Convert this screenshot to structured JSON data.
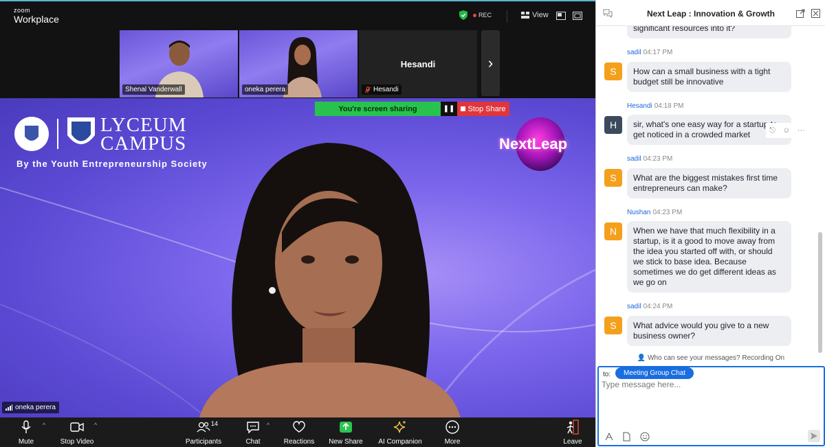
{
  "app": {
    "logo_line1": "zoom",
    "logo_line2": "Workplace",
    "rec_label": "REC",
    "view_label": "View"
  },
  "thumbnails": [
    {
      "name": "Shenal Vanderwall"
    },
    {
      "name": "oneka perera"
    },
    {
      "name": "Hesandi",
      "display_name": "Hesandi",
      "muted": true
    }
  ],
  "main": {
    "screen_sharing_label": "You're screen sharing",
    "stop_share_label": "Stop Share",
    "brand_title_line1": "LYCEUM",
    "brand_title_line2": "CAMPUS",
    "brand_subtitle": "By the Youth Entrepreneurship Society",
    "event_logo": "NextLeap",
    "speaker_name": "oneka perera"
  },
  "toolbar": {
    "mute": "Mute",
    "stop_video": "Stop Video",
    "participants": "Participants",
    "participants_count": "14",
    "chat": "Chat",
    "reactions": "Reactions",
    "new_share": "New Share",
    "ai_companion": "AI Companion",
    "more": "More",
    "leave": "Leave"
  },
  "chat": {
    "title": "Next Leap : Innovation & Growth",
    "partial_message": "significant resources into it?",
    "messages": [
      {
        "sender": "sadil",
        "time": "04:17 PM",
        "initial": "S",
        "color": "#f4a01c",
        "text": "How can a small business with a tight budget still be innovative"
      },
      {
        "sender": "Hesandi",
        "time": "04:18 PM",
        "initial": "H",
        "color": "#3d4a5c",
        "text": "sir, what's one easy way for a startup to get noticed in a crowded market"
      },
      {
        "sender": "sadil",
        "time": "04:23 PM",
        "initial": "S",
        "color": "#f4a01c",
        "text": "What are the biggest mistakes first time entrepreneurs can make?"
      },
      {
        "sender": "Nushan",
        "time": "04:23 PM",
        "initial": "N",
        "color": "#f4a01c",
        "text": "When we have that much flexibility in a startup, is it a good to move away from the idea you started off with, or should we stick to base idea. Because sometimes we do get different ideas as we go on"
      },
      {
        "sender": "sadil",
        "time": "04:24 PM",
        "initial": "S",
        "color": "#f4a01c",
        "text": "What advice would you give to a new business owner?"
      }
    ],
    "visibility_note": "Who can see your messages? Recording On",
    "to_label": "to:",
    "recipient": "Meeting Group Chat",
    "input_placeholder": "Type message here..."
  }
}
